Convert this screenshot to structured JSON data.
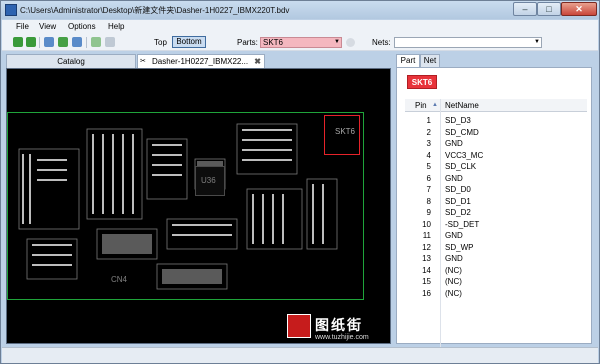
{
  "window": {
    "title": "C:\\Users\\Administrator\\Desktop\\新建文件夹\\Dasher-1H0227_IBMX220T.bdv"
  },
  "menu": [
    "File",
    "View",
    "Options",
    "Help"
  ],
  "toolbar": {
    "top_label": "Top",
    "bottom_label": "Bottom",
    "parts_label": "Parts:",
    "parts_value": "SKT6",
    "nets_label": "Nets:",
    "nets_value": ""
  },
  "tabs": {
    "catalog": "Catalog",
    "board": "Dasher-1H0227_IBMX22..."
  },
  "board": {
    "selected_label": "SKT6",
    "chip_u36": "U36",
    "chip_cn4": "CN4",
    "logo_text": "图纸街",
    "logo_url": "www.tuzhijie.com"
  },
  "right_panel": {
    "tabs": [
      "Part",
      "Net"
    ],
    "part_badge": "SKT6",
    "columns": {
      "pin": "Pin",
      "net": "NetName"
    },
    "rows": [
      {
        "pin": "1",
        "net": "SD_D3"
      },
      {
        "pin": "2",
        "net": "SD_CMD"
      },
      {
        "pin": "3",
        "net": "GND"
      },
      {
        "pin": "4",
        "net": "VCC3_MC"
      },
      {
        "pin": "5",
        "net": "SD_CLK"
      },
      {
        "pin": "6",
        "net": "GND"
      },
      {
        "pin": "7",
        "net": "SD_D0"
      },
      {
        "pin": "8",
        "net": "SD_D1"
      },
      {
        "pin": "9",
        "net": "SD_D2"
      },
      {
        "pin": "10",
        "net": "-SD_DET"
      },
      {
        "pin": "11",
        "net": "GND"
      },
      {
        "pin": "12",
        "net": "SD_WP"
      },
      {
        "pin": "13",
        "net": "GND"
      },
      {
        "pin": "14",
        "net": "(NC)"
      },
      {
        "pin": "15",
        "net": "(NC)"
      },
      {
        "pin": "16",
        "net": "(NC)"
      }
    ]
  },
  "colors": {
    "highlight": "#e8333a",
    "board_outline": "#1fa43a",
    "canvas": "#000000"
  }
}
